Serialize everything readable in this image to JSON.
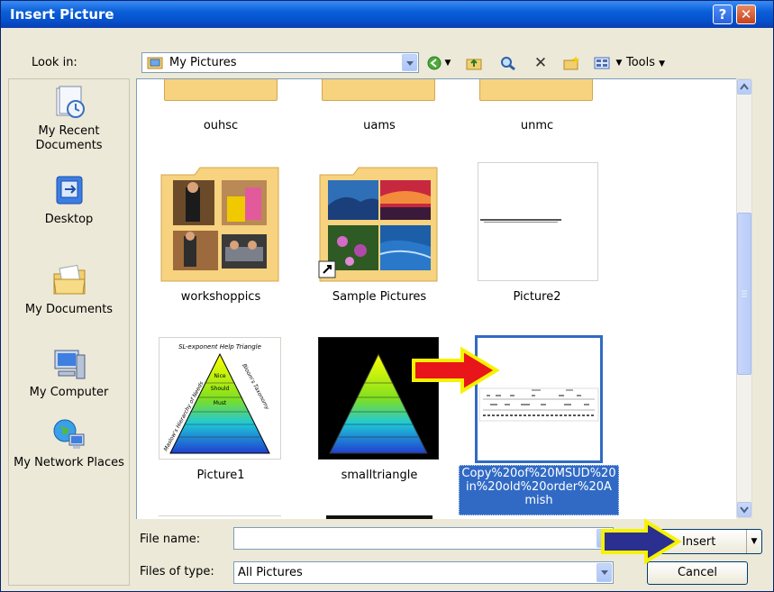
{
  "window": {
    "title": "Insert Picture",
    "help_label": "?",
    "close_label": "✕"
  },
  "toolbar": {
    "look_in_label": "Look in:",
    "look_in_value": "My Pictures",
    "tools_label": "Tools"
  },
  "places": [
    {
      "label": "My Recent Documents",
      "icon": "recent-documents-icon"
    },
    {
      "label": "Desktop",
      "icon": "desktop-icon"
    },
    {
      "label": "My Documents",
      "icon": "my-documents-icon"
    },
    {
      "label": "My Computer",
      "icon": "my-computer-icon"
    },
    {
      "label": "My Network Places",
      "icon": "network-places-icon"
    }
  ],
  "files": {
    "row1": [
      "ouhsc",
      "uams",
      "unmc"
    ],
    "row2": [
      "workshoppics",
      "Sample Pictures",
      "Picture2"
    ],
    "row3": [
      "Picture1",
      "smalltriangle",
      "Copy%20of%20MSUD%20in%20old%20order%20Amish"
    ]
  },
  "triangle": {
    "title": "SL-exponent Help Triangle",
    "levels": [
      "Nice",
      "Should",
      "Must"
    ],
    "side_left": "Maslow's Hierarchy of Needs",
    "side_right": "Bloom's Taxonomy"
  },
  "footer": {
    "file_name_label": "File name:",
    "file_name_value": "",
    "files_of_type_label": "Files of type:",
    "files_of_type_value": "All Pictures",
    "insert_label": "Insert",
    "cancel_label": "Cancel"
  },
  "colors": {
    "title_bar": "#0a5fd8",
    "selection": "#316ac5",
    "folder": "#f7d27f",
    "red_arrow": "#e8151a",
    "blue_arrow": "#2b2f8f",
    "arrow_outline": "#f7f200"
  }
}
